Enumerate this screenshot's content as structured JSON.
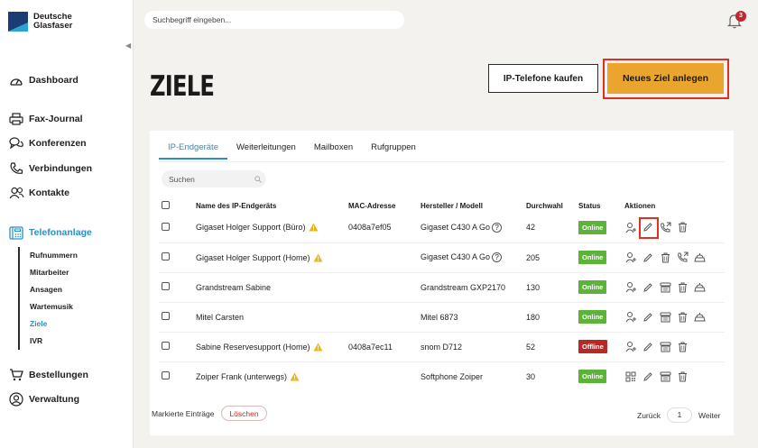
{
  "brand": {
    "line1": "Deutsche",
    "line2": "Glasfaser"
  },
  "topbar": {
    "search_placeholder": "Suchbegriff eingeben...",
    "notification_count": "3"
  },
  "sidebar": {
    "items": [
      {
        "label": "Dashboard",
        "icon": "gauge-icon"
      },
      {
        "label": "Fax-Journal",
        "icon": "printer-icon"
      },
      {
        "label": "Konferenzen",
        "icon": "chat-bubbles-icon"
      },
      {
        "label": "Verbindungen",
        "icon": "phone-icon"
      },
      {
        "label": "Kontakte",
        "icon": "contacts-icon"
      },
      {
        "label": "Telefonanlage",
        "icon": "pbx-icon"
      },
      {
        "label": "Bestellungen",
        "icon": "cart-icon"
      },
      {
        "label": "Verwaltung",
        "icon": "user-circle-icon"
      }
    ],
    "subitems": [
      "Rufnummern",
      "Mitarbeiter",
      "Ansagen",
      "Wartemusik",
      "Ziele",
      "IVR"
    ]
  },
  "page": {
    "title": "ZIELE",
    "buy_button": "IP-Telefone kaufen",
    "new_button": "Neues Ziel anlegen"
  },
  "tabs": [
    "IP-Endgeräte",
    "Weiterleitungen",
    "Mailboxen",
    "Rufgruppen"
  ],
  "table": {
    "search_placeholder": "Suchen",
    "headers": [
      "Name des IP-Endgeräts",
      "MAC-Adresse",
      "Hersteller / Modell",
      "Durchwahl",
      "Status",
      "Aktionen"
    ],
    "rows": [
      {
        "name": "Gigaset Holger Support (Büro)",
        "mac": "0408a7ef05",
        "model": "Gigaset C430 A Go",
        "ext": "42",
        "status": "Online"
      },
      {
        "name": "Gigaset Holger Support (Home)",
        "mac": "",
        "model": "Gigaset C430 A Go",
        "ext": "205",
        "status": "Online"
      },
      {
        "name": "Grandstream Sabine",
        "mac": "",
        "model": "Grandstream GXP2170",
        "ext": "130",
        "status": "Online"
      },
      {
        "name": "Mitel Carsten",
        "mac": "",
        "model": "Mitel 6873",
        "ext": "180",
        "status": "Online"
      },
      {
        "name": "Sabine Reservesupport (Home)",
        "mac": "0408a7ec11",
        "model": "snom D712",
        "ext": "52",
        "status": "Offline"
      },
      {
        "name": "Zoiper Frank (unterwegs)",
        "mac": "",
        "model": "Softphone Zoiper",
        "ext": "30",
        "status": "Online"
      }
    ]
  },
  "footer": {
    "marked_label": "Markierte Einträge",
    "delete_button": "Löschen",
    "back": "Zurück",
    "page": "1",
    "next": "Weiter"
  },
  "colors": {
    "accent": "#2a8fc4",
    "primary_button": "#e9a52d",
    "online": "#5db23a",
    "offline": "#b52a26",
    "highlight": "#e03020"
  }
}
